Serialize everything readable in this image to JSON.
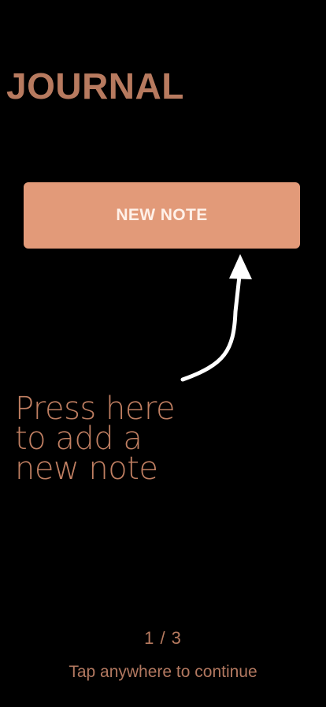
{
  "header": {
    "title": "JOURNAL"
  },
  "main": {
    "new_note_label": "NEW NOTE"
  },
  "tooltip": {
    "hint_lines": [
      "Press here",
      "to add a",
      "new note"
    ],
    "arrow_icon": "curved-arrow-up-icon"
  },
  "footer": {
    "page_indicator": "1 / 3",
    "continue_hint": "Tap anywhere to continue"
  },
  "colors": {
    "background": "#000000",
    "accent": "#e29a79",
    "title_text": "#b77a5f",
    "button_text": "#fff1e9",
    "arrow": "#ffffff"
  }
}
